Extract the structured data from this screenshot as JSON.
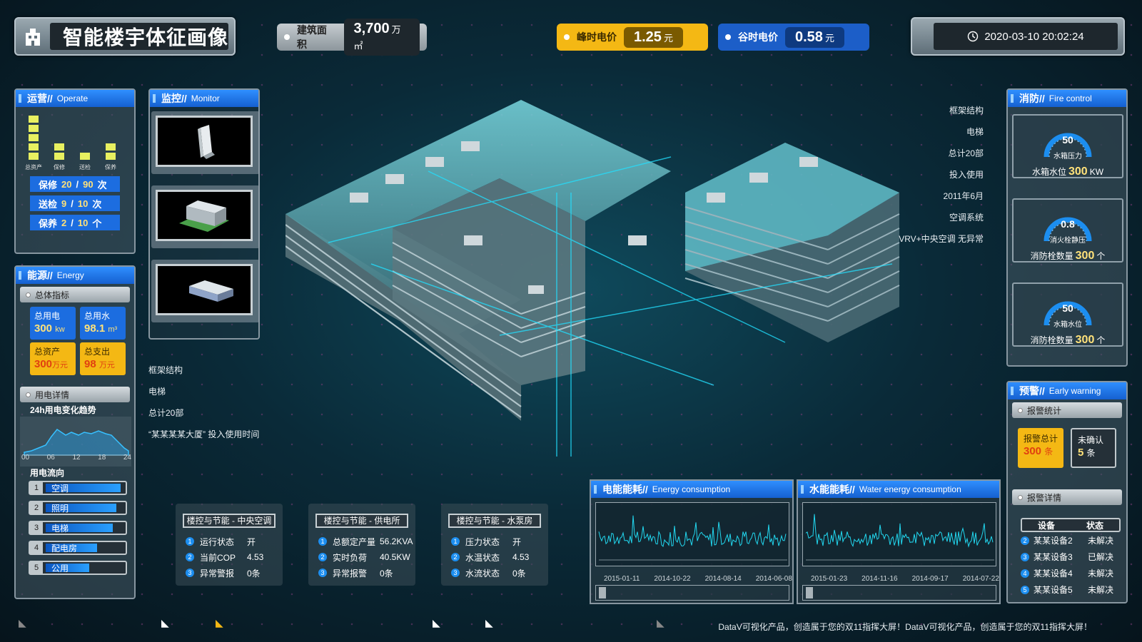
{
  "header": {
    "title": "智能楼宇体征画像",
    "area_label": "建筑面积",
    "area_value": "3,700",
    "area_unit": "万㎡",
    "peak_label": "峰时电价",
    "peak_value": "1.25",
    "peak_unit": "元",
    "valley_label": "谷时电价",
    "valley_value": "0.58",
    "valley_unit": "元",
    "datetime": "2020-03-10 20:02:24"
  },
  "operate": {
    "title": "运营//",
    "title_en": "Operate",
    "bar_labels": [
      "总资产",
      "保修",
      "送检",
      "保养"
    ],
    "bar_levels": [
      5,
      2,
      1,
      2
    ],
    "rows": [
      {
        "label": "保修",
        "a": "20",
        "sep": "/",
        "b": "90",
        "unit": "次"
      },
      {
        "label": "送检",
        "a": "9",
        "sep": "/",
        "b": "10",
        "unit": "次"
      },
      {
        "label": "保养",
        "a": "2",
        "sep": "/",
        "b": "10",
        "unit": "个"
      }
    ]
  },
  "energy": {
    "title": "能源//",
    "title_en": "Energy",
    "overall": "总体指标",
    "elec_label": "总用电",
    "elec_value": "300",
    "elec_unit": "kw",
    "water_label": "总用水",
    "water_value": "98.1",
    "water_unit": "m³",
    "asset_label": "总资产",
    "asset_value": "300",
    "asset_unit": "万元",
    "spend_label": "总支出",
    "spend_value": "98",
    "spend_unit": "万元",
    "detail": "用电详情",
    "trend_title": "24h用电变化趋势",
    "trend_ticks": [
      "00",
      "06",
      "12",
      "18",
      "24"
    ],
    "flow_title": "用电流向",
    "flow": [
      {
        "n": "1",
        "label": "空调",
        "level": 0.95
      },
      {
        "n": "2",
        "label": "照明",
        "level": 0.9
      },
      {
        "n": "3",
        "label": "电梯",
        "level": 0.85
      },
      {
        "n": "4",
        "label": "配电房",
        "level": 0.65
      },
      {
        "n": "5",
        "label": "公用",
        "level": 0.55
      }
    ]
  },
  "monitor": {
    "title": "监控//",
    "title_en": "Monitor"
  },
  "building": {
    "right_labels": [
      "框架结构",
      "电梯",
      "总计20部",
      "投入使用",
      "2011年6月",
      "空调系统",
      "VRV+中央空调 无异常"
    ],
    "left_labels": [
      "框架结构",
      "电梯",
      "总计20部",
      "“某某某某大厦” 投入使用时间"
    ]
  },
  "fire": {
    "title": "消防//",
    "title_en": "Fire control",
    "gauges": [
      {
        "value": "50",
        "name": "水箱压力",
        "text": "水箱水位",
        "num": "300",
        "unit": "KW"
      },
      {
        "value": "0.8",
        "name": "消火栓静压",
        "text": "消防栓数量",
        "num": "300",
        "unit": "个"
      },
      {
        "value": "50",
        "name": "水箱水位",
        "text": "消防栓数量",
        "num": "300",
        "unit": "个"
      }
    ]
  },
  "warning": {
    "title": "预警//",
    "title_en": "Early warning",
    "stats": "报警统计",
    "total_label": "报警总计",
    "total_value": "300",
    "total_unit": "条",
    "unconf_label": "未确认",
    "unconf_value": "5",
    "unconf_unit": "条",
    "details": "报警详情",
    "col_device": "设备",
    "col_state": "状态",
    "rows": [
      {
        "n": "2",
        "device": "某某设备2",
        "state": "未解决"
      },
      {
        "n": "3",
        "device": "某某设备3",
        "state": "已解决"
      },
      {
        "n": "4",
        "device": "某某设备4",
        "state": "未解决"
      },
      {
        "n": "5",
        "device": "某某设备5",
        "state": "未解决"
      }
    ]
  },
  "controls": [
    {
      "title": "楼控与节能 - 中央空调",
      "rows": [
        {
          "n": "1",
          "k": "运行状态",
          "v": "开"
        },
        {
          "n": "2",
          "k": "当前COP",
          "v": "4.53"
        },
        {
          "n": "3",
          "k": "异常警报",
          "v": "0条"
        }
      ]
    },
    {
      "title": "楼控与节能 - 供电所",
      "rows": [
        {
          "n": "1",
          "k": "总额定产量",
          "v": "56.2KVA"
        },
        {
          "n": "2",
          "k": "实时负荷",
          "v": "40.5KW"
        },
        {
          "n": "3",
          "k": "异常报警",
          "v": "0条"
        }
      ]
    },
    {
      "title": "楼控与节能 - 水泵房",
      "rows": [
        {
          "n": "1",
          "k": "压力状态",
          "v": "开"
        },
        {
          "n": "2",
          "k": "水温状态",
          "v": "4.53"
        },
        {
          "n": "3",
          "k": "水流状态",
          "v": "0条"
        }
      ]
    }
  ],
  "consumption": {
    "elec_title": "电能能耗//",
    "elec_en": "Energy consumption",
    "water_title": "水能能耗//",
    "water_en": "Water energy consumption",
    "elec_dates": [
      "2015-01-11",
      "2014-10-22",
      "2014-08-14",
      "2014-06-08"
    ],
    "water_dates": [
      "2015-01-23",
      "2014-11-16",
      "2014-09-17",
      "2014-07-22"
    ]
  },
  "footer": "DataV可视化产品，创造属于您的双11指挥大屏！DataV可视化产品，创造属于您的双11指挥大屏！",
  "colors": {
    "accent_blue": "#1c6de0",
    "accent_yellow": "#f4b814",
    "cyan": "#22e0ff"
  }
}
